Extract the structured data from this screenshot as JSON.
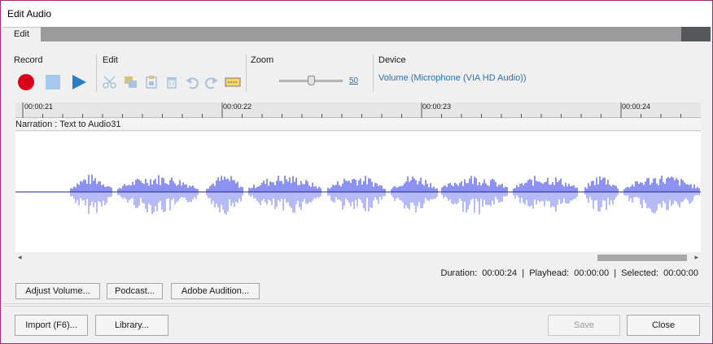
{
  "window": {
    "title": "Edit Audio"
  },
  "tabs": [
    {
      "label": "Edit"
    }
  ],
  "sections": {
    "record": "Record",
    "edit": "Edit",
    "zoom": "Zoom",
    "device": "Device"
  },
  "colors": {
    "record": "#d9001b",
    "stop": "#a6c8ec",
    "play": "#2b7cc4",
    "disabled_tool": "#a9c3dc",
    "waveform": "#8b92f2",
    "waveform_light": "#b6bbf7",
    "center_line": "#24248c"
  },
  "zoom": {
    "value": "50",
    "level": 0.5
  },
  "device": {
    "name": "Volume (Microphone (VIA HD Audio))"
  },
  "ruler": {
    "ticks": [
      "00:00:21",
      "00:00:22",
      "00:00:23",
      "00:00:24"
    ]
  },
  "track": {
    "name": "Narration : Text to Audio31"
  },
  "status": {
    "duration_label": "Duration:",
    "duration": "00:00:24",
    "playhead_label": "Playhead:",
    "playhead": "00:00:00",
    "selected_label": "Selected:",
    "selected": "00:00:00"
  },
  "buttons": {
    "adjust_volume": "Adjust Volume...",
    "podcast": "Podcast...",
    "adobe_audition": "Adobe Audition...",
    "import": "Import (F6)...",
    "library": "Library...",
    "save": "Save",
    "close": "Close"
  },
  "icons": {
    "record": "record-icon",
    "stop": "stop-icon",
    "play": "play-icon",
    "cut": "scissors-icon",
    "copy": "copy-icon",
    "paste": "paste-icon",
    "delete": "trash-icon",
    "undo": "undo-icon",
    "redo": "redo-icon",
    "insert_silence": "insert-silence-icon"
  }
}
